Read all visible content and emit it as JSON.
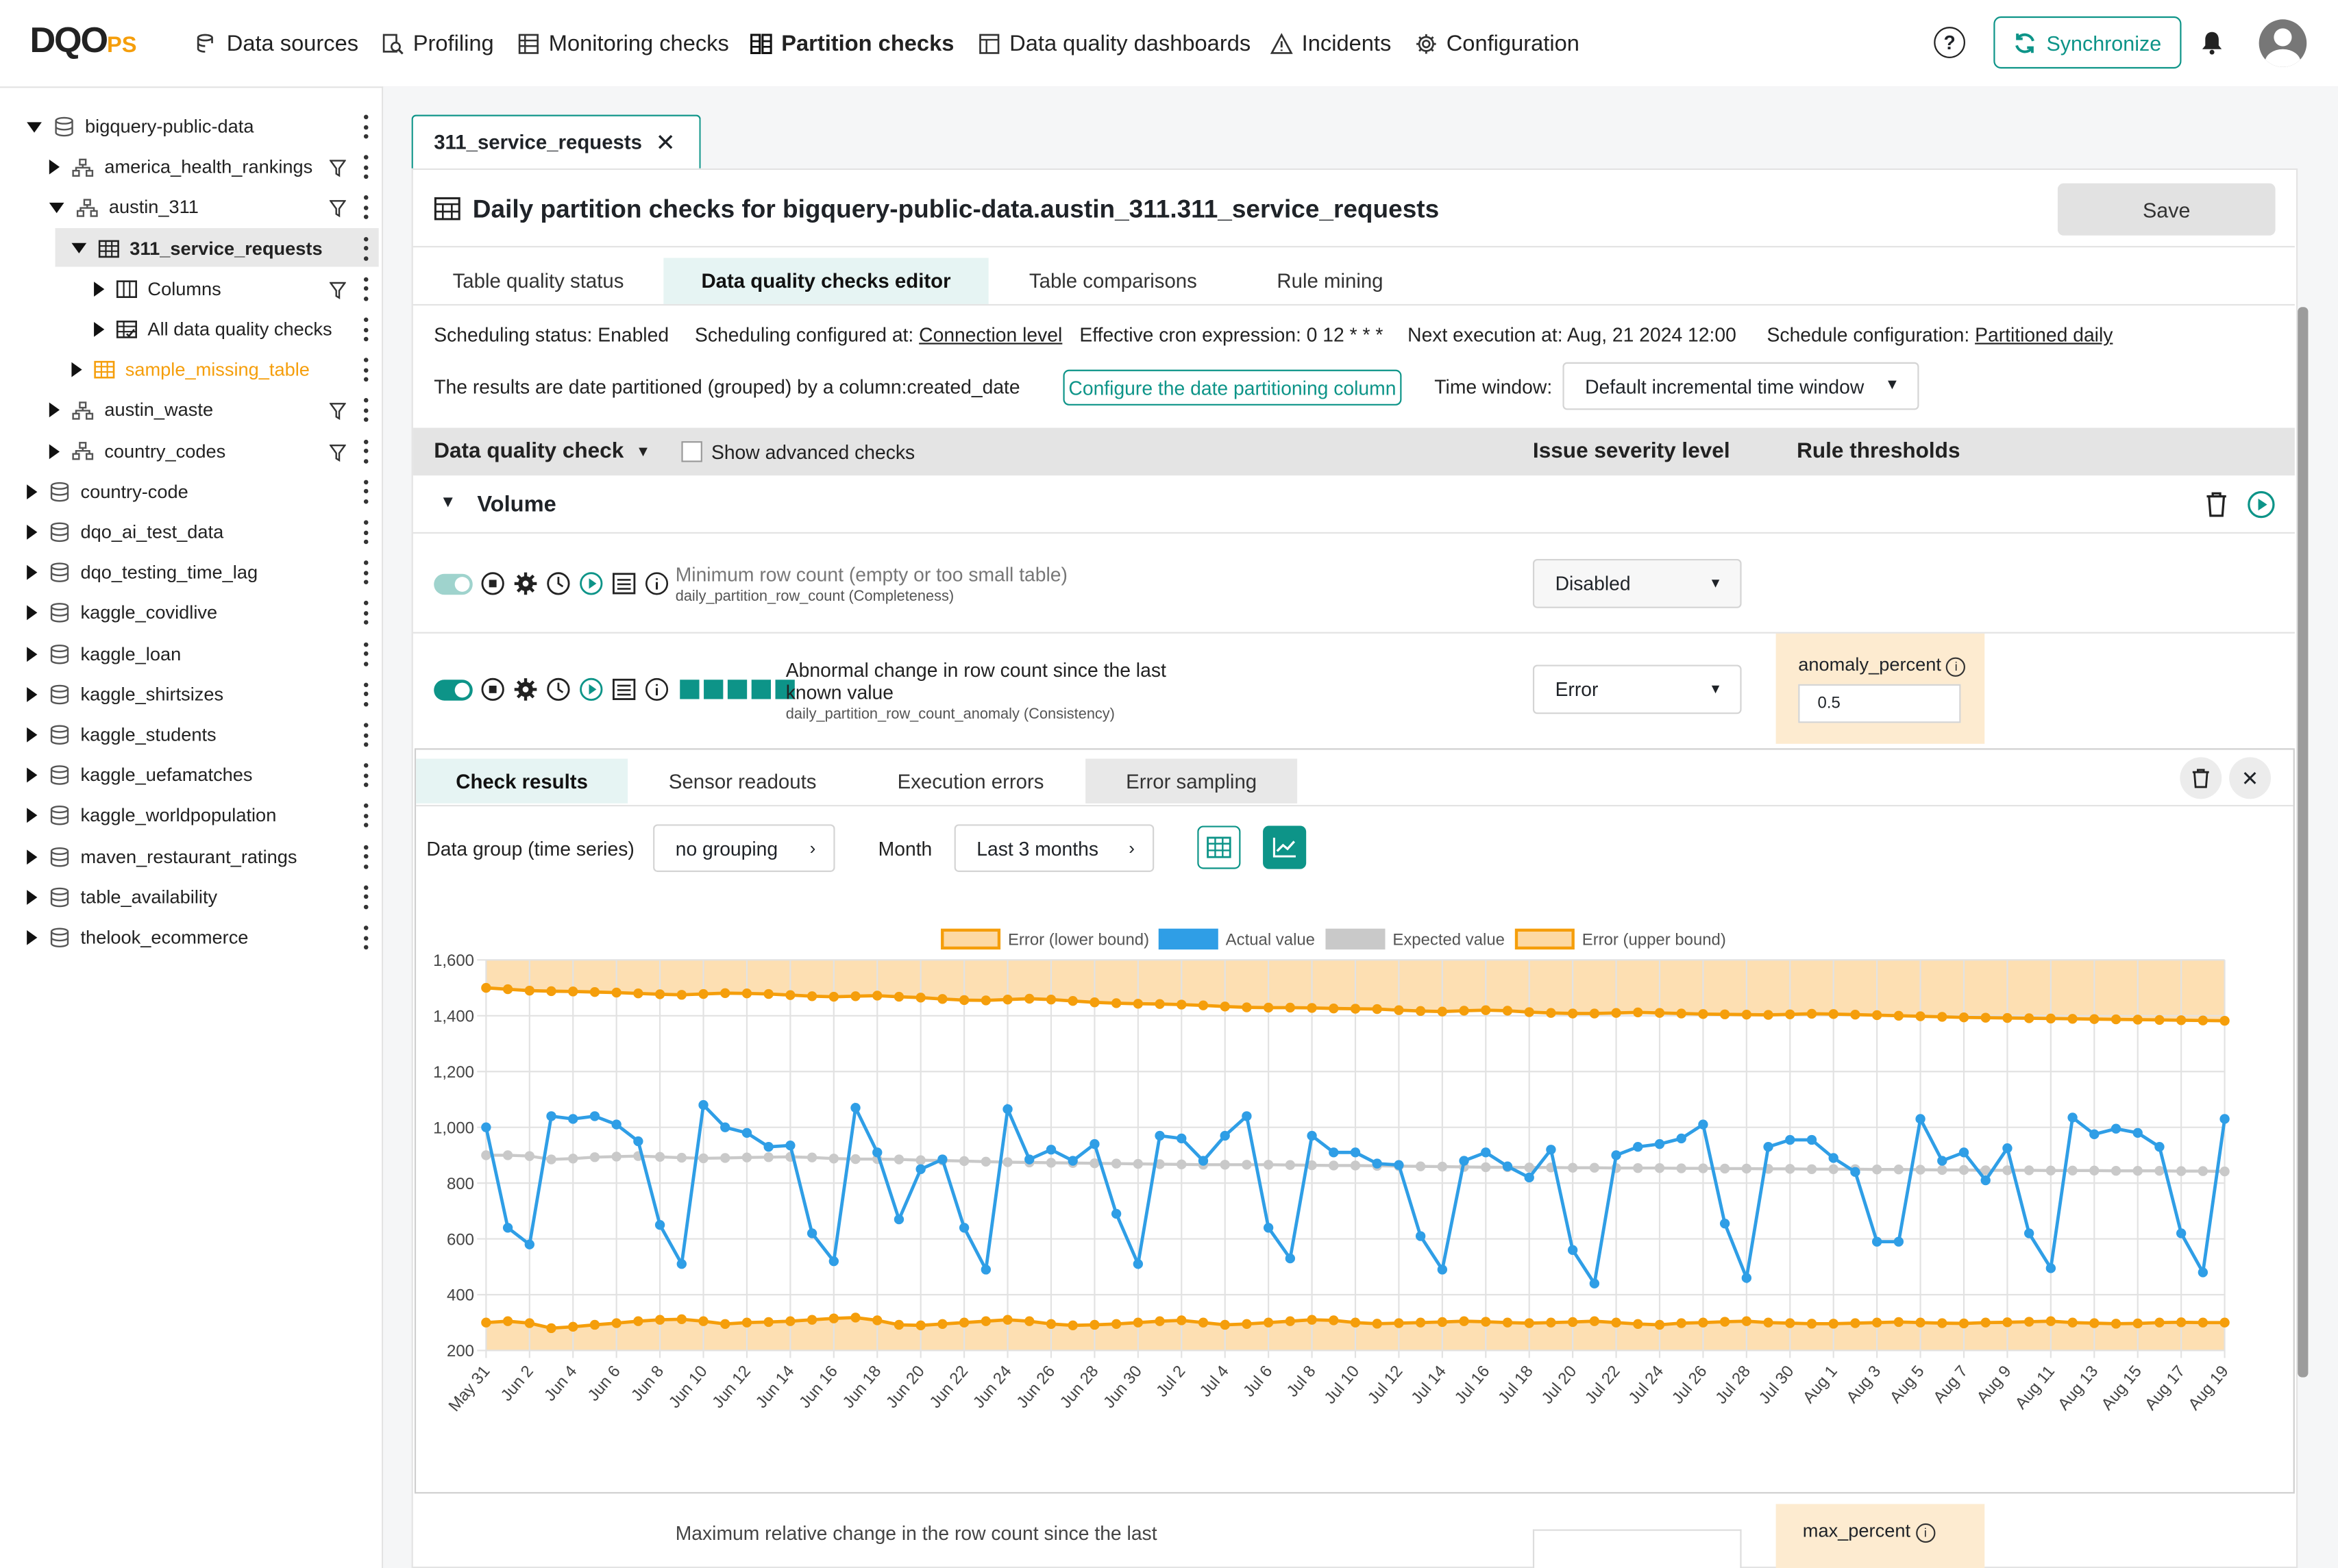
{
  "topbar": {
    "logo_main": "DQO",
    "logo_suffix": "PS",
    "nav": [
      {
        "label": "Data sources",
        "icon": "data-sources-icon",
        "active": false
      },
      {
        "label": "Profiling",
        "icon": "profiling-icon",
        "active": false
      },
      {
        "label": "Monitoring checks",
        "icon": "monitoring-icon",
        "active": false
      },
      {
        "label": "Partition checks",
        "icon": "partition-icon",
        "active": true
      },
      {
        "label": "Data quality dashboards",
        "icon": "dashboard-icon",
        "active": false
      },
      {
        "label": "Incidents",
        "icon": "warning-icon",
        "active": false
      },
      {
        "label": "Configuration",
        "icon": "gear-icon",
        "active": false
      }
    ],
    "sync_label": "Synchronize"
  },
  "sidebar": {
    "items": [
      {
        "label": "bigquery-public-data",
        "depth": 0,
        "expanded": true,
        "type": "database",
        "filter": false
      },
      {
        "label": "america_health_rankings",
        "depth": 1,
        "expanded": false,
        "type": "schema",
        "filter": true
      },
      {
        "label": "austin_311",
        "depth": 1,
        "expanded": true,
        "type": "schema",
        "filter": true
      },
      {
        "label": "311_service_requests",
        "depth": 2,
        "expanded": true,
        "type": "table",
        "filter": false,
        "selected": true
      },
      {
        "label": "Columns",
        "depth": 3,
        "expanded": false,
        "type": "columns",
        "filter": true
      },
      {
        "label": "All data quality checks",
        "depth": 3,
        "expanded": false,
        "type": "checks",
        "filter": false
      },
      {
        "label": "sample_missing_table",
        "depth": 2,
        "expanded": false,
        "type": "table-missing",
        "filter": false
      },
      {
        "label": "austin_waste",
        "depth": 1,
        "expanded": false,
        "type": "schema",
        "filter": true
      },
      {
        "label": "country_codes",
        "depth": 1,
        "expanded": false,
        "type": "schema",
        "filter": true
      },
      {
        "label": "country-code",
        "depth": 0,
        "expanded": false,
        "type": "database",
        "filter": false
      },
      {
        "label": "dqo_ai_test_data",
        "depth": 0,
        "expanded": false,
        "type": "database",
        "filter": false
      },
      {
        "label": "dqo_testing_time_lag",
        "depth": 0,
        "expanded": false,
        "type": "database",
        "filter": false
      },
      {
        "label": "kaggle_covidlive",
        "depth": 0,
        "expanded": false,
        "type": "database",
        "filter": false
      },
      {
        "label": "kaggle_loan",
        "depth": 0,
        "expanded": false,
        "type": "database",
        "filter": false
      },
      {
        "label": "kaggle_shirtsizes",
        "depth": 0,
        "expanded": false,
        "type": "database",
        "filter": false
      },
      {
        "label": "kaggle_students",
        "depth": 0,
        "expanded": false,
        "type": "database",
        "filter": false
      },
      {
        "label": "kaggle_uefamatches",
        "depth": 0,
        "expanded": false,
        "type": "database",
        "filter": false
      },
      {
        "label": "kaggle_worldpopulation",
        "depth": 0,
        "expanded": false,
        "type": "database",
        "filter": false
      },
      {
        "label": "maven_restaurant_ratings",
        "depth": 0,
        "expanded": false,
        "type": "database",
        "filter": false
      },
      {
        "label": "table_availability",
        "depth": 0,
        "expanded": false,
        "type": "database",
        "filter": false
      },
      {
        "label": "thelook_ecommerce",
        "depth": 0,
        "expanded": false,
        "type": "database",
        "filter": false
      }
    ]
  },
  "editor": {
    "open_tab": "311_service_requests",
    "title": "Daily partition checks for bigquery-public-data.austin_311.311_service_requests",
    "save_label": "Save",
    "subtabs": [
      "Table quality status",
      "Data quality checks editor",
      "Table comparisons",
      "Rule mining"
    ],
    "scheduling_status": "Scheduling status: Enabled",
    "scheduling_configured_prefix": "Scheduling configured at:",
    "scheduling_configured_link": "Connection level",
    "cron": "Effective cron expression: 0 12 * * *",
    "next_execution": "Next execution at: Aug, 21 2024 12:00",
    "schedule_config_prefix": "Schedule configuration:",
    "schedule_config_link": "Partitioned daily",
    "partition_text": "The results are date partitioned (grouped) by a column:created_date",
    "configure_partition_button": "Configure the date partitioning column",
    "time_window_label": "Time window:",
    "time_window_value": "Default incremental time window",
    "header": {
      "check": "Data quality check",
      "advanced": "Show advanced checks",
      "severity": "Issue severity level",
      "thresholds": "Rule thresholds"
    },
    "category": "Volume",
    "checks": [
      {
        "title": "Minimum row count (empty or too small table)",
        "name": "daily_partition_row_count (Completeness)",
        "severity": "Disabled",
        "enabled": false
      },
      {
        "title": "Abnormal change in row count since the last known value",
        "name": "daily_partition_row_count_anomaly (Consistency)",
        "severity": "Error",
        "enabled": true,
        "param_label": "anomaly_percent",
        "param_value": "0.5"
      },
      {
        "title": "Maximum relative change in the row count since the last",
        "param_label": "max_percent"
      }
    ]
  },
  "results": {
    "tabs": [
      "Check results",
      "Sensor readouts",
      "Execution errors",
      "Error sampling"
    ],
    "group_label": "Data group (time series)",
    "group_value": "no grouping",
    "month_label": "Month",
    "month_value": "Last 3 months"
  },
  "colors": {
    "accent": "#0d9488",
    "actual": "#2f9ee6",
    "expected": "#c9c9c9",
    "bound": "#f59e0b",
    "band": "#fdd9a4"
  },
  "chart_data": {
    "type": "line",
    "legend": [
      "Error (lower bound)",
      "Actual value",
      "Expected value",
      "Error (upper bound)"
    ],
    "legend_position": "top",
    "ylim": [
      200,
      1600
    ],
    "yticks": [
      200,
      400,
      600,
      800,
      1000,
      1200,
      1400,
      1600
    ],
    "x": [
      "May 31",
      "Jun 1",
      "Jun 2",
      "Jun 3",
      "Jun 4",
      "Jun 5",
      "Jun 6",
      "Jun 7",
      "Jun 8",
      "Jun 9",
      "Jun 10",
      "Jun 11",
      "Jun 12",
      "Jun 13",
      "Jun 14",
      "Jun 15",
      "Jun 16",
      "Jun 17",
      "Jun 18",
      "Jun 19",
      "Jun 20",
      "Jun 21",
      "Jun 22",
      "Jun 23",
      "Jun 24",
      "Jun 25",
      "Jun 26",
      "Jun 27",
      "Jun 28",
      "Jun 29",
      "Jun 30",
      "Jul 1",
      "Jul 2",
      "Jul 3",
      "Jul 4",
      "Jul 5",
      "Jul 6",
      "Jul 7",
      "Jul 8",
      "Jul 9",
      "Jul 10",
      "Jul 11",
      "Jul 12",
      "Jul 13",
      "Jul 14",
      "Jul 15",
      "Jul 16",
      "Jul 17",
      "Jul 18",
      "Jul 19",
      "Jul 20",
      "Jul 21",
      "Jul 22",
      "Jul 23",
      "Jul 24",
      "Jul 25",
      "Jul 26",
      "Jul 27",
      "Jul 28",
      "Jul 29",
      "Jul 30",
      "Jul 31",
      "Aug 1",
      "Aug 2",
      "Aug 3",
      "Aug 4",
      "Aug 5",
      "Aug 6",
      "Aug 7",
      "Aug 8",
      "Aug 9",
      "Aug 10",
      "Aug 11",
      "Aug 12",
      "Aug 13",
      "Aug 14",
      "Aug 15",
      "Aug 16",
      "Aug 17",
      "Aug 18",
      "Aug 19"
    ],
    "xtick_labels": [
      "May 31",
      "Jun 2",
      "Jun 4",
      "Jun 6",
      "Jun 8",
      "Jun 10",
      "Jun 12",
      "Jun 14",
      "Jun 16",
      "Jun 18",
      "Jun 20",
      "Jun 22",
      "Jun 24",
      "Jun 26",
      "Jun 28",
      "Jun 30",
      "Jul 2",
      "Jul 4",
      "Jul 6",
      "Jul 8",
      "Jul 10",
      "Jul 12",
      "Jul 14",
      "Jul 16",
      "Jul 18",
      "Jul 20",
      "Jul 22",
      "Jul 24",
      "Jul 26",
      "Jul 28",
      "Jul 30",
      "Aug 1",
      "Aug 3",
      "Aug 5",
      "Aug 7",
      "Aug 9",
      "Aug 11",
      "Aug 13",
      "Aug 15",
      "Aug 17",
      "Aug 19"
    ],
    "series": [
      {
        "name": "Actual value",
        "values": [
          1000,
          640,
          580,
          1040,
          1030,
          1040,
          1010,
          950,
          650,
          510,
          1080,
          1000,
          980,
          930,
          935,
          620,
          520,
          1070,
          910,
          670,
          850,
          885,
          640,
          490,
          1065,
          885,
          920,
          880,
          940,
          690,
          510,
          970,
          960,
          880,
          970,
          1040,
          640,
          530,
          970,
          910,
          910,
          870,
          865,
          610,
          490,
          880,
          910,
          860,
          820,
          920,
          560,
          440,
          900,
          930,
          940,
          960,
          1010,
          655,
          460,
          930,
          955,
          955,
          890,
          840,
          590,
          590,
          1030,
          880,
          910,
          810,
          925,
          620,
          495,
          1035,
          975,
          995,
          980,
          930,
          620,
          480,
          1030
        ]
      },
      {
        "name": "Expected value",
        "values": [
          900,
          900,
          897,
          885,
          888,
          893,
          895,
          897,
          894,
          891,
          889,
          890,
          892,
          893,
          894,
          892,
          888,
          886,
          886,
          885,
          882,
          881,
          879,
          877,
          875,
          874,
          873,
          872,
          871,
          870,
          869,
          868,
          867,
          866,
          866,
          866,
          866,
          865,
          864,
          863,
          863,
          862,
          861,
          860,
          859,
          858,
          857,
          857,
          856,
          856,
          855,
          855,
          854,
          854,
          854,
          853,
          853,
          852,
          852,
          851,
          851,
          850,
          850,
          850,
          849,
          849,
          848,
          847,
          847,
          846,
          846,
          846,
          845,
          845,
          845,
          844,
          844,
          844,
          843,
          843,
          842
        ]
      },
      {
        "name": "Error (upper bound)",
        "values": [
          1500,
          1495,
          1490,
          1488,
          1487,
          1485,
          1483,
          1480,
          1477,
          1475,
          1478,
          1481,
          1480,
          1478,
          1474,
          1470,
          1468,
          1470,
          1472,
          1468,
          1465,
          1460,
          1456,
          1455,
          1458,
          1461,
          1458,
          1453,
          1448,
          1445,
          1443,
          1442,
          1440,
          1437,
          1433,
          1430,
          1429,
          1429,
          1428,
          1426,
          1425,
          1424,
          1420,
          1417,
          1415,
          1418,
          1420,
          1418,
          1413,
          1410,
          1408,
          1408,
          1410,
          1412,
          1410,
          1408,
          1406,
          1405,
          1404,
          1403,
          1405,
          1407,
          1406,
          1404,
          1402,
          1400,
          1398,
          1396,
          1394,
          1393,
          1392,
          1391,
          1390,
          1389,
          1388,
          1387,
          1386,
          1385,
          1384,
          1383,
          1382
        ]
      },
      {
        "name": "Error (lower bound)",
        "values": [
          300,
          305,
          298,
          280,
          285,
          292,
          298,
          305,
          310,
          312,
          305,
          295,
          300,
          302,
          305,
          310,
          315,
          318,
          308,
          292,
          290,
          295,
          300,
          305,
          310,
          305,
          295,
          290,
          292,
          295,
          300,
          305,
          308,
          300,
          292,
          295,
          300,
          305,
          310,
          308,
          300,
          296,
          298,
          300,
          302,
          305,
          303,
          300,
          298,
          300,
          302,
          305,
          300,
          295,
          292,
          298,
          300,
          303,
          305,
          300,
          298,
          296,
          296,
          298,
          300,
          302,
          300,
          298,
          297,
          300,
          301,
          303,
          305,
          300,
          298,
          296,
          297,
          300,
          301,
          300,
          300
        ]
      }
    ]
  }
}
